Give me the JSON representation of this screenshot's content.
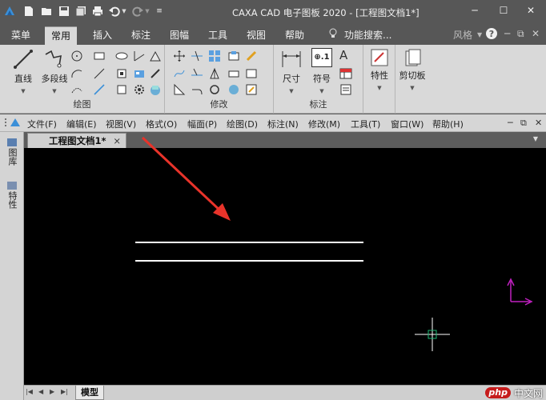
{
  "window": {
    "title": "CAXA CAD 电子图板 2020 - [工程图文档1*]",
    "controls": {
      "minimize": "─",
      "restore": "☐",
      "close": "✕"
    }
  },
  "ribbon_tabs": [
    "菜单",
    "常用",
    "插入",
    "标注",
    "图幅",
    "工具",
    "视图",
    "帮助"
  ],
  "active_tab": "常用",
  "search": {
    "label": "功能搜索..."
  },
  "style_label": "风格",
  "ribbon": {
    "draw_group": {
      "label": "绘图",
      "line": "直线",
      "polyline": "多段线"
    },
    "modify_group": {
      "label": "修改"
    },
    "annotate_group": {
      "label": "标注",
      "dimension": "尺寸",
      "symbol": "符号",
      "symbol_glyph": "⊕.1",
      "text_glyph": "A"
    },
    "properties": {
      "label": "特性"
    },
    "clipboard": {
      "label": "剪切板"
    }
  },
  "menubar": [
    "文件(F)",
    "编辑(E)",
    "视图(V)",
    "格式(O)",
    "幅面(P)",
    "绘图(D)",
    "标注(N)",
    "修改(M)",
    "工具(T)",
    "窗口(W)",
    "帮助(H)"
  ],
  "document_tab": {
    "label": "工程图文档1*",
    "close": "×"
  },
  "side_panel": [
    "图库",
    "特性"
  ],
  "model_tab": "模型",
  "watermark": {
    "logo": "php",
    "text": "中文网"
  },
  "colors": {
    "canvas": "#000000",
    "arrow": "#e8332a",
    "ucs": "#c020c0",
    "crosshair": "#ffffff",
    "aperture": "#1db874"
  }
}
